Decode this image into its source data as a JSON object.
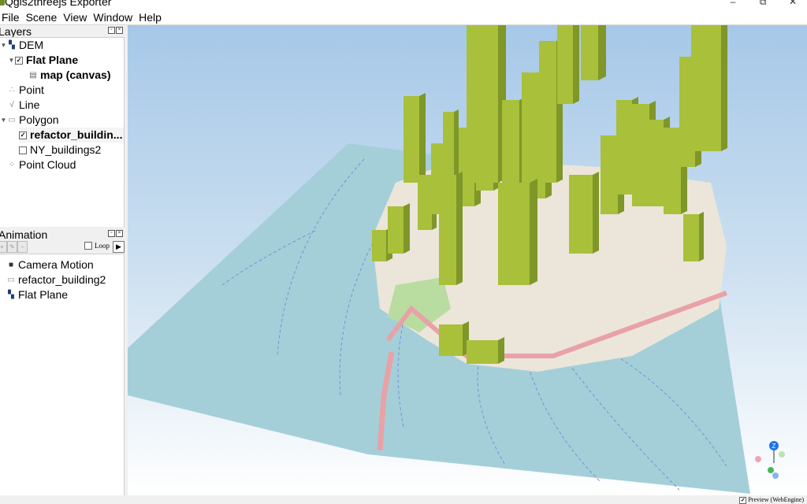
{
  "window": {
    "title": "Qgis2threejs Exporter",
    "minimize": "–",
    "maximize": "⧉",
    "close": "✕"
  },
  "menu": [
    "File",
    "Scene",
    "View",
    "Window",
    "Help"
  ],
  "layers_panel": {
    "title": "Layers",
    "items": [
      {
        "label": "DEM",
        "icon": "dem-icon"
      },
      {
        "label": "Flat Plane",
        "checked": true
      },
      {
        "label": "map (canvas)",
        "icon": "raster-icon"
      },
      {
        "label": "Point",
        "icon": "point-icon"
      },
      {
        "label": "Line",
        "icon": "line-icon"
      },
      {
        "label": "Polygon",
        "icon": "polygon-icon"
      },
      {
        "label": "refactor_buildin...",
        "checked": true
      },
      {
        "label": "NY_buildings2",
        "checked": false
      },
      {
        "label": "Point Cloud",
        "icon": "point-cloud-icon"
      }
    ]
  },
  "animation_panel": {
    "title": "Animation",
    "loop_label": "Loop",
    "loop_checked": false,
    "items": [
      {
        "label": "Camera Motion",
        "icon": "camera-icon"
      },
      {
        "label": "refactor_building2",
        "icon": "polygon-icon"
      },
      {
        "label": "Flat Plane",
        "icon": "dem-icon"
      }
    ]
  },
  "status": {
    "preview_label": "Preview (WebEngine)",
    "preview_checked": true
  },
  "navigator": {
    "axis_label": "Z"
  },
  "colors": {
    "building": "#a9c03a",
    "building_dark": "#7f9629",
    "water": "#a3ced9",
    "land": "#eee7dc",
    "road": "#e7a1a6"
  }
}
